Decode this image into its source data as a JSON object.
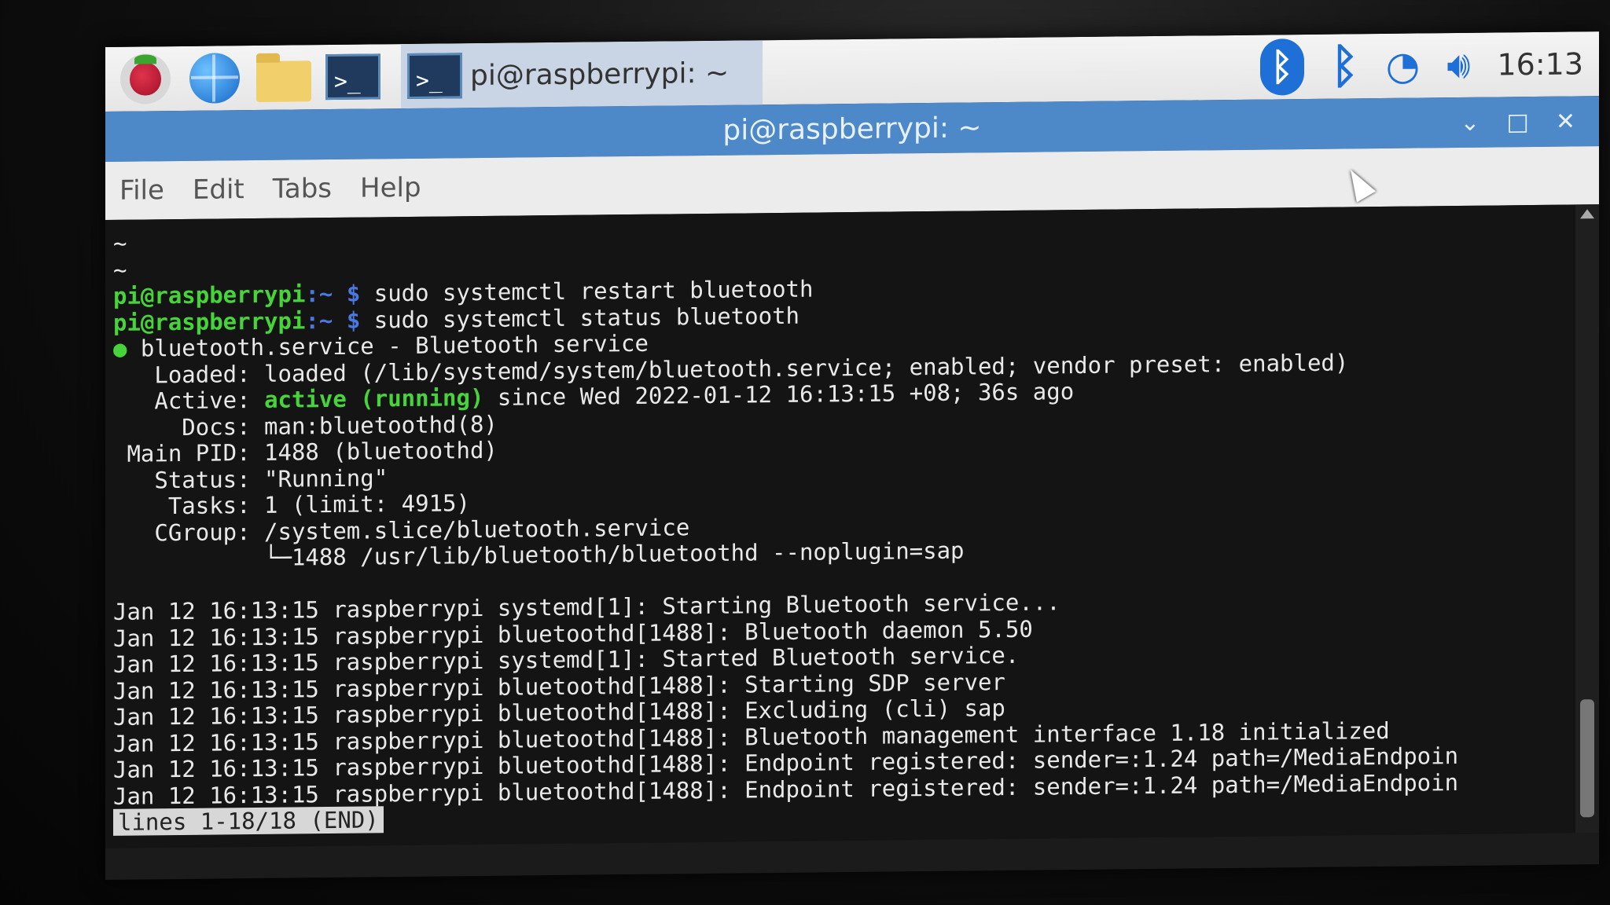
{
  "taskbar": {
    "task_title": "pi@raspberrypi: ~",
    "clock": "16:13",
    "icons": [
      "raspberry-menu-icon",
      "web-browser-icon",
      "file-manager-icon",
      "terminal-icon",
      "bluetooth-icon",
      "wifi-icon",
      "volume-icon"
    ]
  },
  "window": {
    "title": "pi@raspberrypi: ~",
    "controls": {
      "minimize": "⌄",
      "maximize": "□",
      "close": "✕"
    }
  },
  "menu": {
    "file": "File",
    "edit": "Edit",
    "tabs": "Tabs",
    "help": "Help"
  },
  "terminal": {
    "tilde1": "~",
    "tilde2": "~",
    "prompt_user": "pi@raspberrypi",
    "prompt_path": ":~ $",
    "cmd1": " sudo systemctl restart bluetooth",
    "cmd2": " sudo systemctl status bluetooth",
    "service_dot": "●",
    "service_line": " bluetooth.service - Bluetooth service",
    "loaded": "   Loaded: loaded (/lib/systemd/system/bluetooth.service; enabled; vendor preset: enabled)",
    "active_label": "   Active: ",
    "active_state": "active (running)",
    "active_rest": " since Wed 2022-01-12 16:13:15 +08; 36s ago",
    "docs": "     Docs: man:bluetoothd(8)",
    "main_pid": " Main PID: 1488 (bluetoothd)",
    "status": "   Status: \"Running\"",
    "tasks": "    Tasks: 1 (limit: 4915)",
    "cgroup": "   CGroup: /system.slice/bluetooth.service",
    "cgroup_child": "           └─1488 /usr/lib/bluetooth/bluetoothd --noplugin=sap",
    "log": [
      "Jan 12 16:13:15 raspberrypi systemd[1]: Starting Bluetooth service...",
      "Jan 12 16:13:15 raspberrypi bluetoothd[1488]: Bluetooth daemon 5.50",
      "Jan 12 16:13:15 raspberrypi systemd[1]: Started Bluetooth service.",
      "Jan 12 16:13:15 raspberrypi bluetoothd[1488]: Starting SDP server",
      "Jan 12 16:13:15 raspberrypi bluetoothd[1488]: Excluding (cli) sap",
      "Jan 12 16:13:15 raspberrypi bluetoothd[1488]: Bluetooth management interface 1.18 initialized",
      "Jan 12 16:13:15 raspberrypi bluetoothd[1488]: Endpoint registered: sender=:1.24 path=/MediaEndpoin",
      "Jan 12 16:13:15 raspberrypi bluetoothd[1488]: Endpoint registered: sender=:1.24 path=/MediaEndpoin"
    ],
    "pager": "lines 1-18/18 (END)"
  }
}
